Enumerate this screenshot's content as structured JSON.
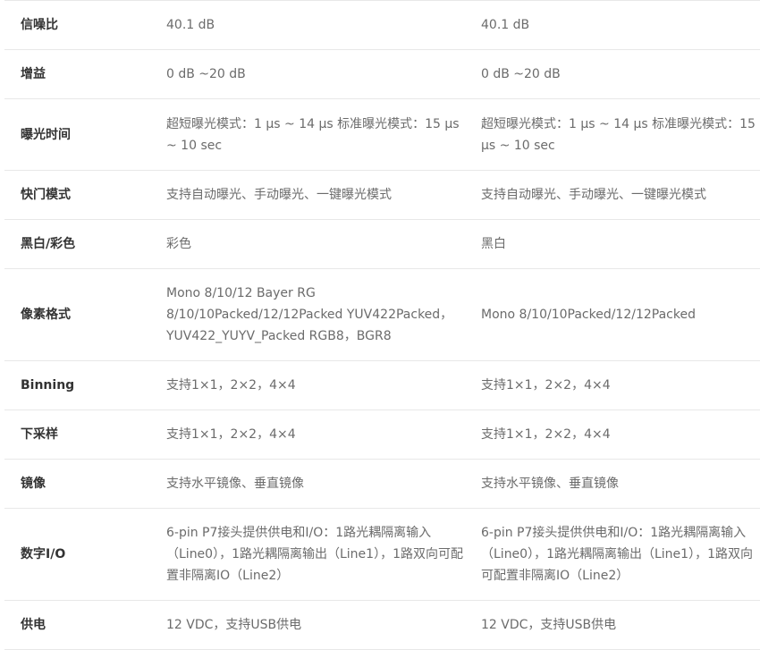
{
  "rows": [
    {
      "label": "信噪比",
      "col1": "40.1 dB",
      "col2": "40.1 dB"
    },
    {
      "label": "增益",
      "col1": "0 dB ~20 dB",
      "col2": "0 dB ~20 dB"
    },
    {
      "label": "曝光时间",
      "col1": "超短曝光模式：1 μs ~ 14 μs 标准曝光模式：15 μs ~ 10 sec",
      "col2": "超短曝光模式：1 μs ~ 14 μs 标准曝光模式：15 μs ~ 10 sec"
    },
    {
      "label": "快门模式",
      "col1": "支持自动曝光、手动曝光、一键曝光模式",
      "col2": "支持自动曝光、手动曝光、一键曝光模式"
    },
    {
      "label": "黑白/彩色",
      "col1": "彩色",
      "col2": "黑白"
    },
    {
      "label": "像素格式",
      "col1": "Mono 8/10/12 Bayer RG 8/10/10Packed/12/12Packed YUV422Packed，YUV422_YUYV_Packed RGB8，BGR8",
      "col2": "Mono 8/10/10Packed/12/12Packed"
    },
    {
      "label": "Binning",
      "col1": "支持1×1，2×2，4×4",
      "col2": "支持1×1，2×2，4×4"
    },
    {
      "label": "下采样",
      "col1": "支持1×1，2×2，4×4",
      "col2": "支持1×1，2×2，4×4"
    },
    {
      "label": "镜像",
      "col1": "支持水平镜像、垂直镜像",
      "col2": "支持水平镜像、垂直镜像"
    },
    {
      "label": "数字I/O",
      "col1": "6-pin P7接头提供供电和I/O：1路光耦隔离输入（Line0），1路光耦隔离输出（Line1），1路双向可配置非隔离IO（Line2）",
      "col2": "6-pin P7接头提供供电和I/O：1路光耦隔离输入（Line0），1路光耦隔离输出（Line1），1路双向可配置非隔离IO（Line2）"
    },
    {
      "label": "供电",
      "col1": "12 VDC，支持USB供电",
      "col2": "12 VDC，支持USB供电"
    }
  ]
}
